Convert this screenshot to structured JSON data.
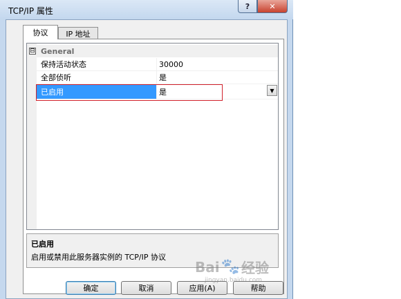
{
  "window": {
    "title": "TCP/IP 属性",
    "help_glyph": "?",
    "close_glyph": "✕"
  },
  "tabs": [
    {
      "label": "协议",
      "active": true
    },
    {
      "label": "IP 地址",
      "active": false
    }
  ],
  "grid": {
    "category": {
      "expander": "⊟",
      "label": "General"
    },
    "properties": [
      {
        "name": "保持活动状态",
        "value": "30000"
      },
      {
        "name": "全部侦听",
        "value": "是"
      },
      {
        "name": "已启用",
        "value": "是",
        "selected": true
      }
    ],
    "dropdown_glyph": "▼"
  },
  "description": {
    "title": "已启用",
    "text": "启用或禁用此服务器实例的 TCP/IP 协议"
  },
  "buttons": {
    "ok": "确定",
    "cancel": "取消",
    "apply": "应用(A)",
    "help": "帮助"
  },
  "watermark": {
    "brand_left": "Bai",
    "brand_right": "经验",
    "sub": "jingyan.baidu.com"
  },
  "colors": {
    "selection": "#3399ff",
    "highlight": "#d0202a",
    "close": "#c8422e"
  }
}
